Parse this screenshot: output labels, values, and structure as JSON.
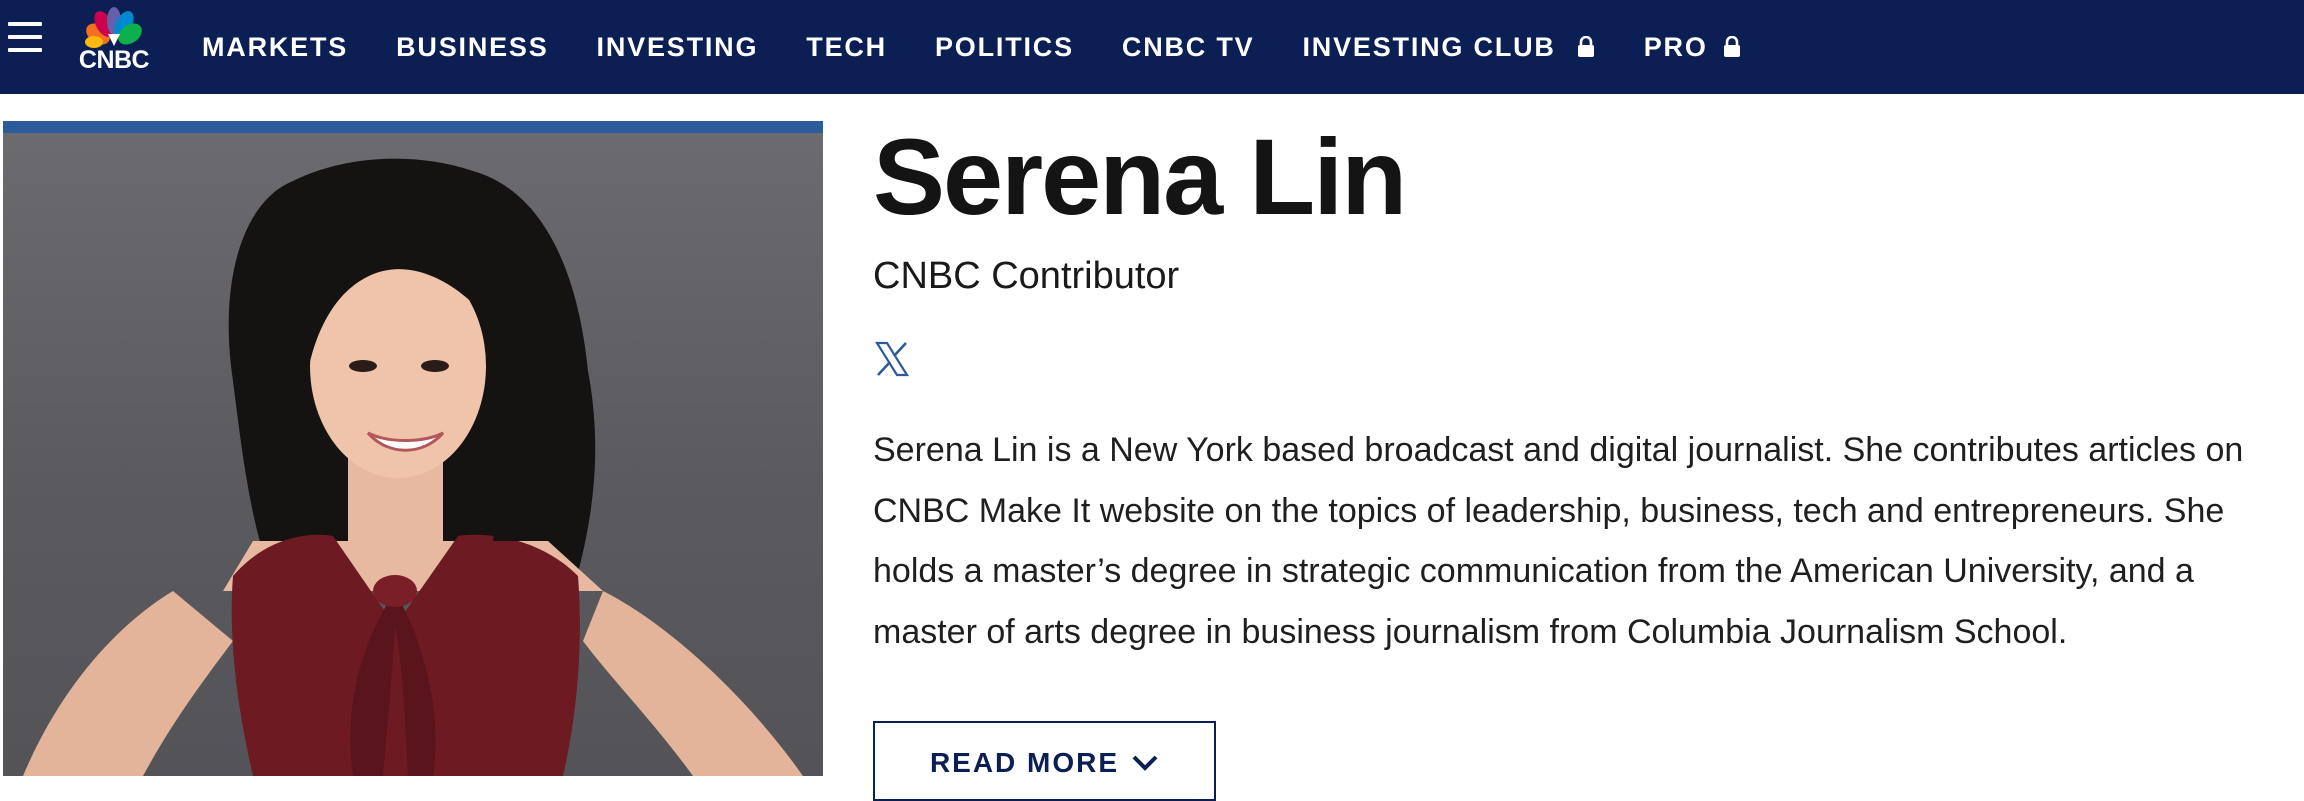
{
  "nav": {
    "menu_icon": "hamburger-menu-icon",
    "logo_icon": "cnbc-peacock-logo-icon",
    "logo_text": "CNBC",
    "items": [
      {
        "label": "MARKETS",
        "locked": false
      },
      {
        "label": "BUSINESS",
        "locked": false
      },
      {
        "label": "INVESTING",
        "locked": false
      },
      {
        "label": "TECH",
        "locked": false
      },
      {
        "label": "POLITICS",
        "locked": false
      },
      {
        "label": "CNBC TV",
        "locked": false
      },
      {
        "label": "INVESTING CLUB",
        "locked": true
      },
      {
        "label": "PRO",
        "locked": true
      }
    ],
    "lock_icon": "lock-icon",
    "background_color": "#0b1f54"
  },
  "author": {
    "photo_alt": "Serena Lin",
    "name": "Serena Lin",
    "title": "CNBC Contributor",
    "social_icon": "x-twitter-icon",
    "bio": "Serena Lin is a New York based broadcast and digital journalist. She contributes articles on CNBC Make It website on the topics of leadership, business, tech and entrepreneurs. She holds a master’s degree in strategic communication from the American University, and a master of arts degree in business journalism from Columbia Journalism School.",
    "read_more_label": "READ MORE",
    "read_more_icon": "chevron-down-icon",
    "accent_color": "#2d5a9a"
  }
}
